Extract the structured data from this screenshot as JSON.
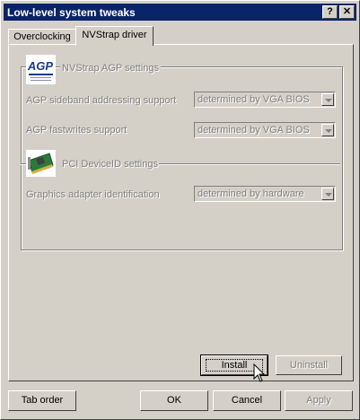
{
  "window": {
    "title": "Low-level system tweaks",
    "help_btn": "?",
    "close_btn": "✕"
  },
  "tabs": [
    {
      "label": "Overclocking"
    },
    {
      "label": "NVStrap driver"
    }
  ],
  "agp_group": {
    "icon": "agp-logo-icon",
    "title": "NVStrap AGP settings",
    "rows": [
      {
        "label": "AGP sideband addressing support",
        "value": "determined by VGA BIOS"
      },
      {
        "label": "AGP fastwrites support",
        "value": "determined by VGA BIOS"
      }
    ]
  },
  "pci_group": {
    "icon": "graphics-card-icon",
    "title": "PCI DeviceID settings",
    "rows": [
      {
        "label": "Graphics adapter identification",
        "value": "determined by hardware"
      }
    ]
  },
  "panel_buttons": {
    "install": "Install",
    "uninstall": "Uninstall"
  },
  "footer_buttons": {
    "tab_order": "Tab order",
    "ok": "OK",
    "cancel": "Cancel",
    "apply": "Apply"
  },
  "colors": {
    "titlebar": "#0a246a",
    "face": "#d4d0c8",
    "disabled_text": "#808080"
  }
}
